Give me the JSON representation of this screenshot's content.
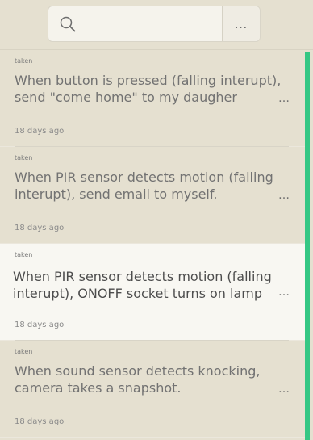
{
  "search": {
    "placeholder": "",
    "more_label": "…"
  },
  "tasks": [
    {
      "status": "taken",
      "text": "When button is pressed (falling interupt), send \"come home\" to my daugher",
      "menu_label": "…",
      "time": "18 days ago"
    },
    {
      "status": "taken",
      "text": "When PIR sensor detects motion (falling interupt), send email to myself.",
      "menu_label": "…",
      "time": "18 days ago"
    },
    {
      "status": "taken",
      "text": "When PIR sensor detects motion (falling interupt), ONOFF socket turns on lamp",
      "menu_label": "…",
      "time": "18 days ago"
    },
    {
      "status": "taken",
      "text": "When sound sensor detects knocking, camera takes a snapshot.",
      "menu_label": "…",
      "time": "18 days ago"
    }
  ],
  "icons": {
    "search": "search-icon",
    "more": "more-options-icon"
  },
  "colors": {
    "background": "#e5e0d0",
    "accent": "#35c784",
    "highlight": "#f8f7f2"
  }
}
